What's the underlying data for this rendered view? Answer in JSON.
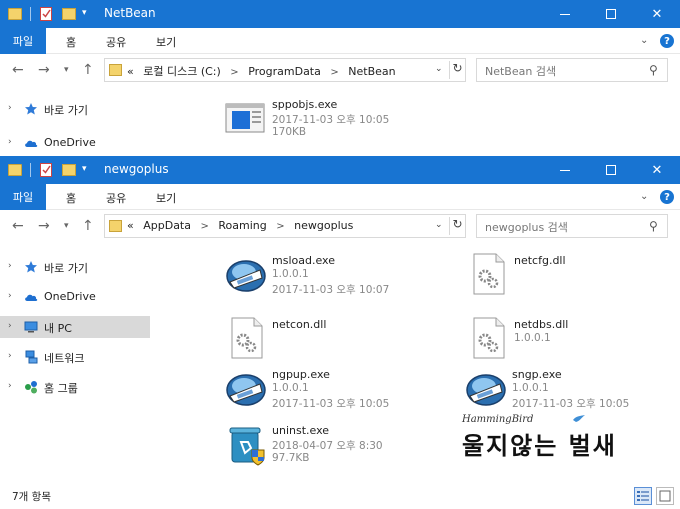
{
  "windows": [
    {
      "title": "NetBean",
      "ribbon_tabs": [
        "파일",
        "홈",
        "공유",
        "보기"
      ],
      "nav": {
        "crumbs": [
          "«",
          "로컬 디스크 (C:)",
          ">",
          "ProgramData",
          ">",
          "NetBean"
        ],
        "search_placeholder": "NetBean 검색"
      },
      "sidebar": [
        {
          "label": "바로 가기",
          "icon": "star-icon"
        },
        {
          "label": "OneDrive",
          "icon": "cloud-icon"
        }
      ],
      "files": [
        {
          "name": "sppobjs.exe",
          "meta1": "2017-11-03 오후 10:05",
          "meta2": "170KB",
          "icon": "window-exe-icon"
        }
      ]
    },
    {
      "title": "newgoplus",
      "ribbon_tabs": [
        "파일",
        "홈",
        "공유",
        "보기"
      ],
      "nav": {
        "crumbs": [
          "«",
          "AppData",
          ">",
          "Roaming",
          ">",
          "newgoplus"
        ],
        "search_placeholder": "newgoplus 검색"
      },
      "sidebar": [
        {
          "label": "바로 가기",
          "icon": "star-icon"
        },
        {
          "label": "OneDrive",
          "icon": "cloud-icon"
        },
        {
          "label": "내 PC",
          "icon": "pc-icon"
        },
        {
          "label": "네트워크",
          "icon": "network-icon"
        },
        {
          "label": "홈 그룹",
          "icon": "homegroup-icon"
        }
      ],
      "files": [
        {
          "name": "msload.exe",
          "meta1": "1.0.0.1",
          "meta2": "2017-11-03 오후 10:07",
          "icon": "globe-exe-icon"
        },
        {
          "name": "netcfg.dll",
          "meta1": "",
          "meta2": "",
          "icon": "dll-gear-icon"
        },
        {
          "name": "netcon.dll",
          "meta1": "",
          "meta2": "",
          "icon": "dll-gear-icon"
        },
        {
          "name": "netdbs.dll",
          "meta1": "1.0.0.1",
          "meta2": "",
          "icon": "dll-gear-icon"
        },
        {
          "name": "ngpup.exe",
          "meta1": "1.0.0.1",
          "meta2": "2017-11-03 오후 10:05",
          "icon": "globe-exe-icon"
        },
        {
          "name": "sngp.exe",
          "meta1": "1.0.0.1",
          "meta2": "2017-11-03 오후 10:05",
          "icon": "globe-exe-icon"
        },
        {
          "name": "uninst.exe",
          "meta1": "2018-04-07 오후 8:30",
          "meta2": "97.7KB",
          "icon": "recycle-bin-shield-icon"
        }
      ],
      "status": "7개 항목"
    }
  ],
  "watermark": {
    "en": "HammingBird",
    "ko": "울지않는 벌새"
  },
  "colors": {
    "titlebar": "#1874d2",
    "selected": "#d9d9d9",
    "meta": "#888888"
  }
}
